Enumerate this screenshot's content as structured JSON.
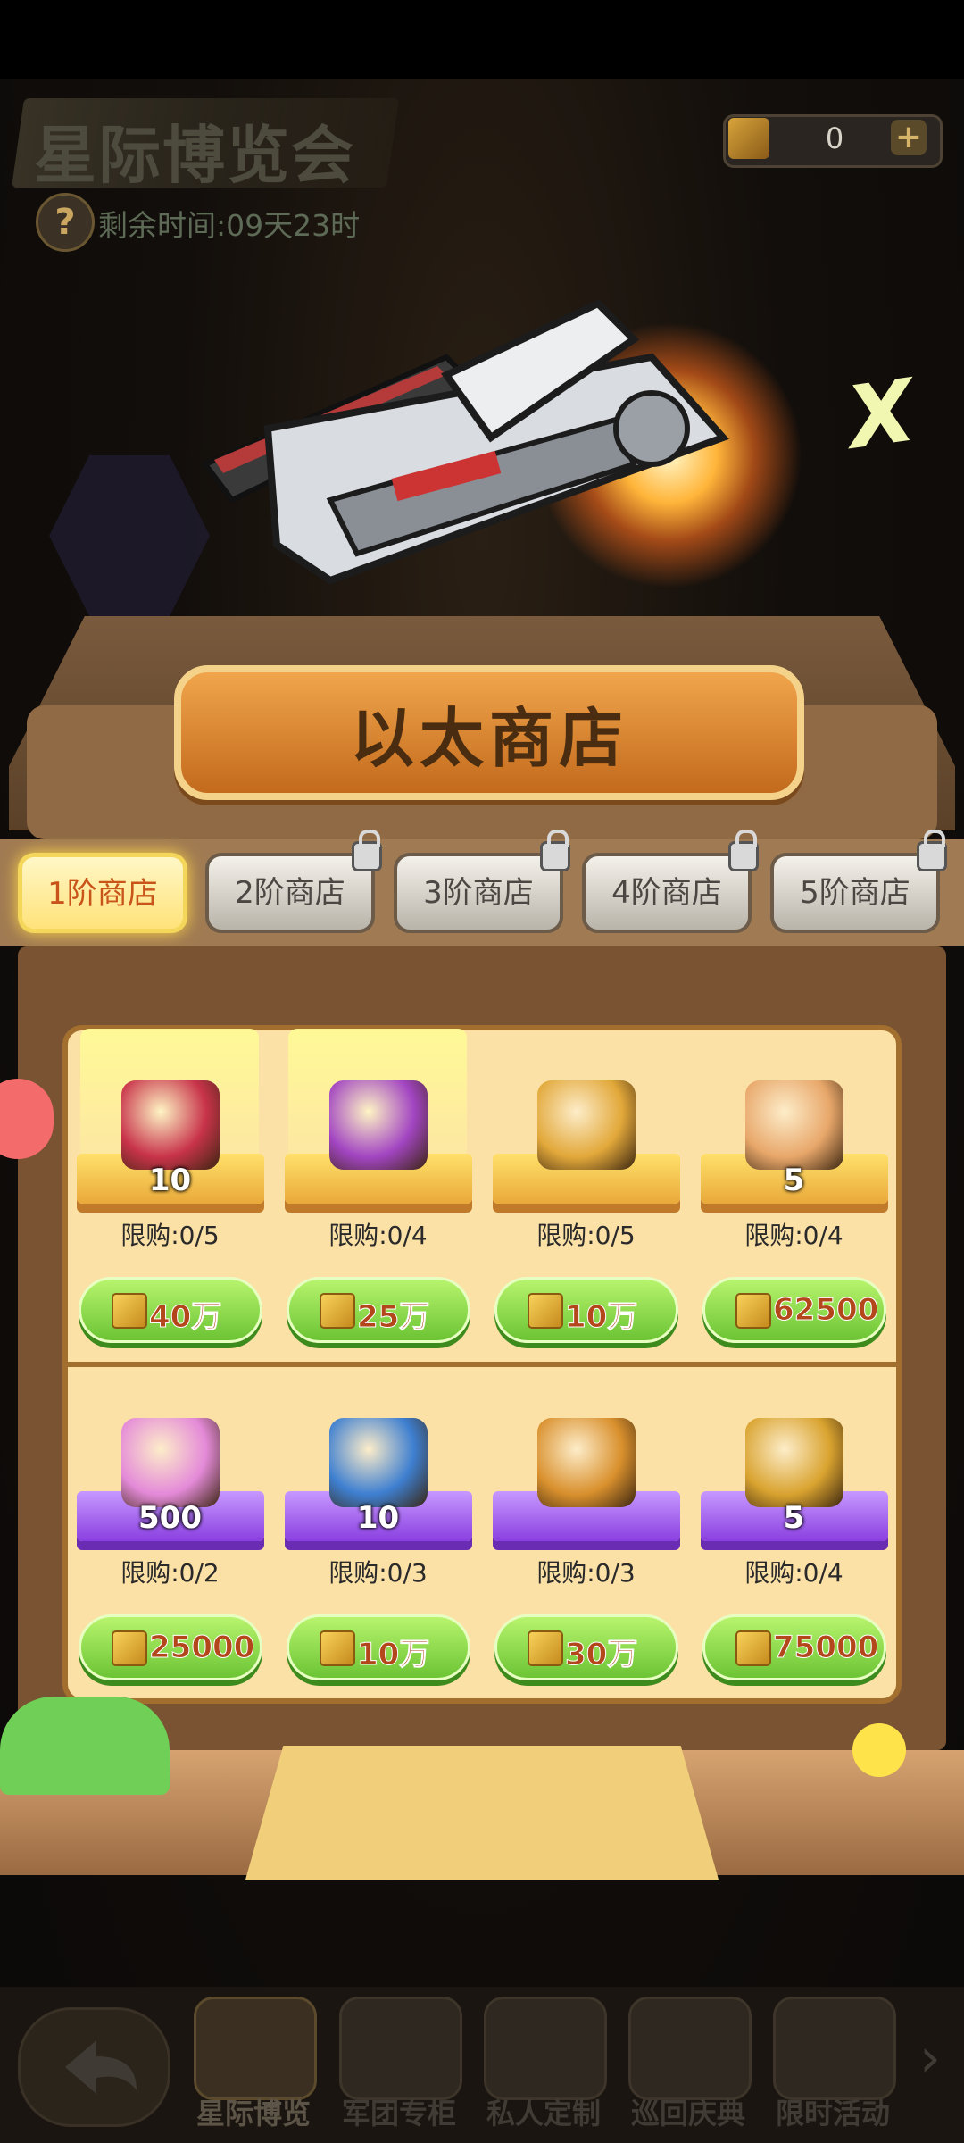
{
  "header": {
    "event_title": "星际博览会",
    "timer": "剩余时间:09天23时",
    "currency_value": "0"
  },
  "shop": {
    "title": "以太商店",
    "tabs": [
      {
        "label": "1阶商店",
        "locked": false
      },
      {
        "label": "2阶商店",
        "locked": true
      },
      {
        "label": "3阶商店",
        "locked": true
      },
      {
        "label": "4阶商店",
        "locked": true
      },
      {
        "label": "5阶商店",
        "locked": true
      }
    ],
    "items": [
      {
        "icon": "red-treasure-chest-icon",
        "qty": "10",
        "limit": "限购:0/5",
        "price": "40万",
        "pedestal": "gold"
      },
      {
        "icon": "gift-bundle-icon",
        "qty": "",
        "limit": "限购:0/4",
        "price": "25万",
        "pedestal": "gold"
      },
      {
        "icon": "rainbow-key-icon",
        "qty": "",
        "limit": "限购:0/5",
        "price": "10万",
        "pedestal": "gold"
      },
      {
        "icon": "puzzle-piece-icon",
        "qty": "5",
        "limit": "限购:0/4",
        "price": "62500",
        "pedestal": "gold"
      },
      {
        "icon": "pink-diamond-icon",
        "qty": "500",
        "limit": "限购:0/2",
        "price": "25000",
        "pedestal": "purple"
      },
      {
        "icon": "jeweled-cube-icon",
        "qty": "10",
        "limit": "限购:0/3",
        "price": "10万",
        "pedestal": "purple"
      },
      {
        "icon": "golden-box-icon",
        "qty": "",
        "limit": "限购:0/3",
        "price": "30万",
        "pedestal": "purple"
      },
      {
        "icon": "golden-orb-icon",
        "qty": "5",
        "limit": "限购:0/4",
        "price": "75000",
        "pedestal": "purple"
      }
    ]
  },
  "bottom_nav": [
    {
      "label": "星际博览",
      "active": true
    },
    {
      "label": "军团专柜",
      "active": false
    },
    {
      "label": "私人定制",
      "active": false
    },
    {
      "label": "巡回庆典",
      "active": false
    },
    {
      "label": "限时活动",
      "active": false
    }
  ],
  "close_label": "X",
  "colors": {
    "accent": "#6cc434",
    "price_text": "#b3461a",
    "active_tab": "#ffe27a"
  }
}
